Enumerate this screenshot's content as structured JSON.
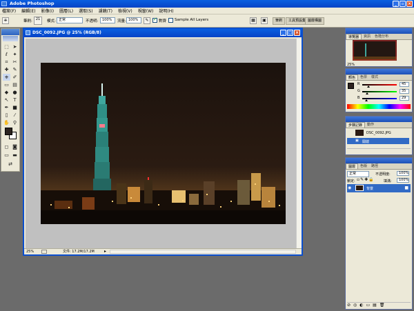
{
  "app": {
    "title": "Adobe Photoshop"
  },
  "menu": [
    "檔案(F)",
    "編輯(E)",
    "影像(I)",
    "圖層(L)",
    "選取(S)",
    "濾鏡(T)",
    "檢視(V)",
    "視窗(W)",
    "說明(H)"
  ],
  "options": {
    "brush_label": "筆刷:",
    "brush_size": "21",
    "mode_label": "模式:",
    "mode_value": "正常",
    "opacity_label": "不透明:",
    "opacity_value": "100%",
    "flow_label": "流量:",
    "flow_value": "100%",
    "align_label": "對齊",
    "sample_label": "Sample All Layers"
  },
  "palette_well": [
    "筆刷",
    "工具預設集",
    "圖層構圖"
  ],
  "document": {
    "title": "DSC_0092.JPG @ 25% (RGB/8)",
    "zoom": "25%",
    "doc_info": "文件: 17.2M/17.2M"
  },
  "navigator": {
    "tabs": [
      "導覽器",
      "資訊",
      "色階分布"
    ],
    "zoom": "25%"
  },
  "color_panel": {
    "tabs": [
      "顏色",
      "色票",
      "樣式"
    ],
    "channels": [
      {
        "label": "R",
        "value": "45",
        "fraction": 0.18
      },
      {
        "label": "G",
        "value": "35",
        "fraction": 0.14
      },
      {
        "label": "B",
        "value": "29",
        "fraction": 0.11
      }
    ]
  },
  "history": {
    "tabs": [
      "步驟記錄",
      "動作"
    ],
    "snapshot": "DSC_0092.JPG",
    "step": "開啟"
  },
  "layers": {
    "tabs": [
      "圖層",
      "色版",
      "路徑"
    ],
    "blend": "正常",
    "opacity_label": "不透明度:",
    "opacity": "100%",
    "lock_label": "鎖定:",
    "fill_label": "填滿:",
    "fill": "100%",
    "layer_name": "背景"
  },
  "colors": {
    "accent": "#0a5fe0",
    "foreground": "#2d2320"
  }
}
